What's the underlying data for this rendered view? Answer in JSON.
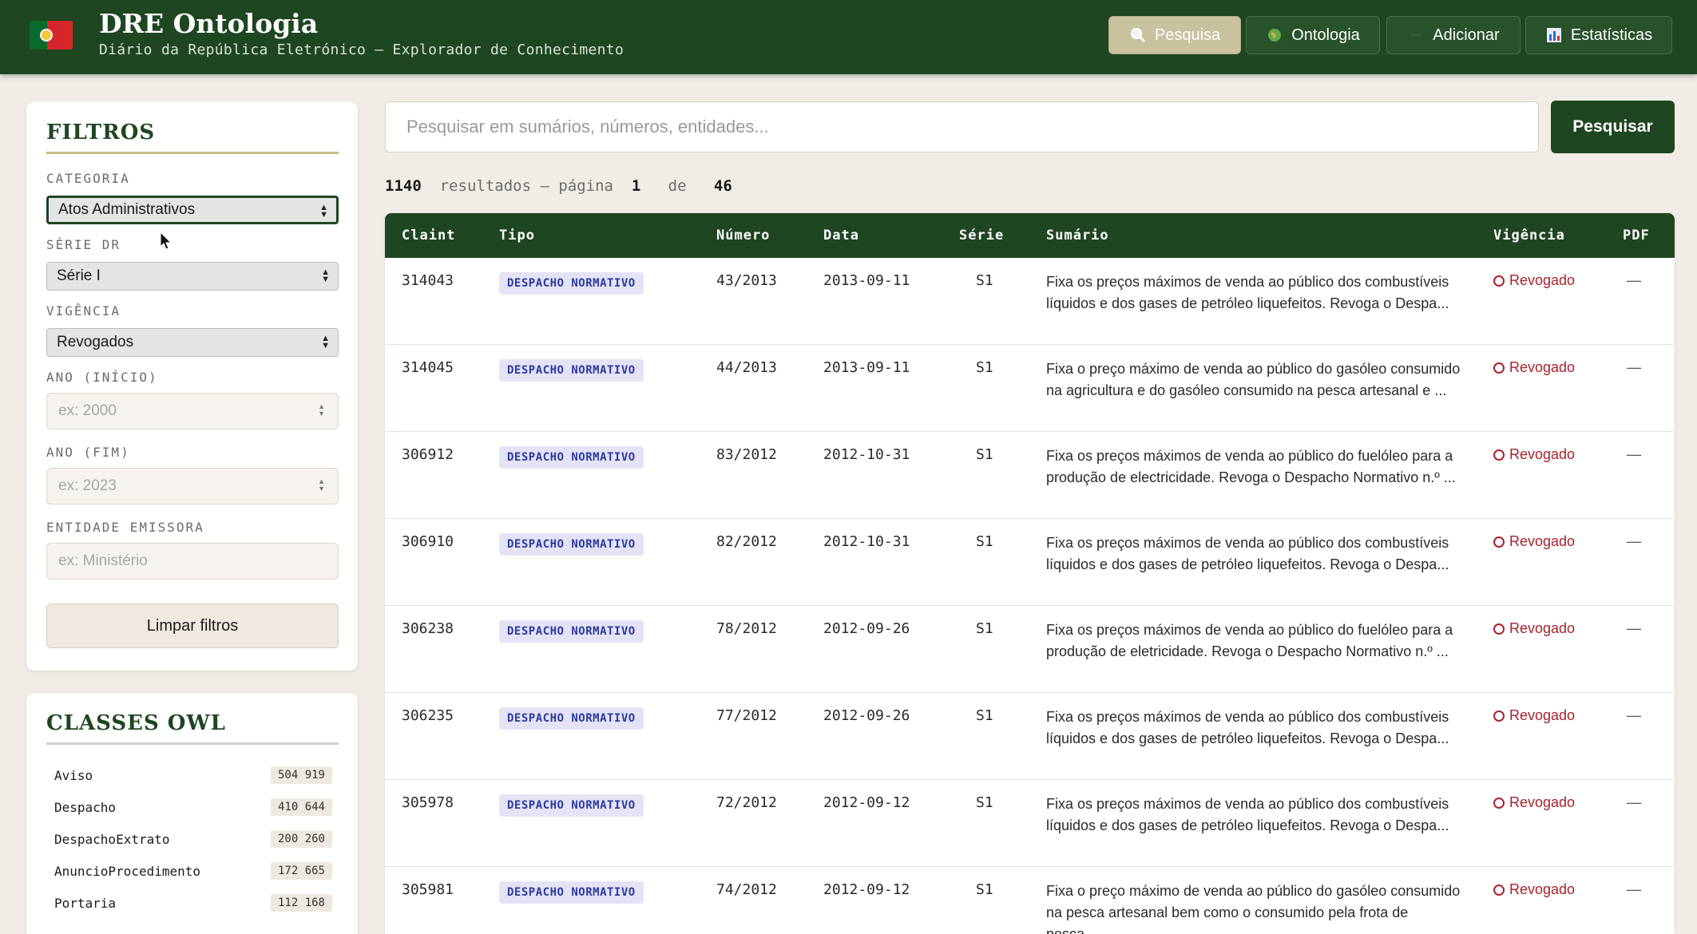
{
  "header": {
    "title": "DRE Ontologia",
    "subtitle": "Diário da República Eletrónico — Explorador de Conhecimento",
    "nav": [
      {
        "label": "Pesquisa",
        "icon": "magnifier-icon",
        "active": true
      },
      {
        "label": "Ontologia",
        "icon": "globe-icon",
        "active": false
      },
      {
        "label": "Adicionar",
        "icon": "plus-icon",
        "active": false
      },
      {
        "label": "Estatísticas",
        "icon": "bar-chart-icon",
        "active": false
      }
    ]
  },
  "filters": {
    "title": "FILTROS",
    "categoria": {
      "label": "CATEGORIA",
      "value": "Atos Administrativos"
    },
    "serie": {
      "label": "SÉRIE DR",
      "value": "Série I"
    },
    "vigencia": {
      "label": "VIGÊNCIA",
      "value": "Revogados"
    },
    "ano_inicio": {
      "label": "ANO (INÍCIO)",
      "placeholder": "ex: 2000"
    },
    "ano_fim": {
      "label": "ANO (FIM)",
      "placeholder": "ex: 2023"
    },
    "entidade": {
      "label": "ENTIDADE EMISSORA",
      "placeholder": "ex: Ministério"
    },
    "clear_label": "Limpar filtros"
  },
  "owl": {
    "title": "CLASSES OWL",
    "classes": [
      {
        "name": "Aviso",
        "count": "504 919"
      },
      {
        "name": "Despacho",
        "count": "410 644"
      },
      {
        "name": "DespachoExtrato",
        "count": "200 260"
      },
      {
        "name": "AnuncioProcedimento",
        "count": "172 665"
      },
      {
        "name": "Portaria",
        "count": "112 168"
      }
    ]
  },
  "search": {
    "placeholder": "Pesquisar em sumários, números, entidades...",
    "button_label": "Pesquisar"
  },
  "results": {
    "count": "1140",
    "text_resultados": "resultados — página",
    "page": "1",
    "text_de": "de",
    "total_pages": "46"
  },
  "table": {
    "headers": {
      "claint": "Claint",
      "tipo": "Tipo",
      "numero": "Número",
      "data": "Data",
      "serie": "Série",
      "sumario": "Sumário",
      "vigencia": "Vigência",
      "pdf": "PDF"
    },
    "rows": [
      {
        "claint": "314043",
        "tipo": "DESPACHO NORMATIVO",
        "numero": "43/2013",
        "data": "2013-09-11",
        "serie": "S1",
        "sumario": "Fixa os preços máximos de venda ao público dos combustíveis líquidos e dos gases de petróleo liquefeitos. Revoga o Despa...",
        "vigencia": "Revogado",
        "pdf": "—"
      },
      {
        "claint": "314045",
        "tipo": "DESPACHO NORMATIVO",
        "numero": "44/2013",
        "data": "2013-09-11",
        "serie": "S1",
        "sumario": "Fixa o preço máximo de venda ao público do gasóleo consumido na agricultura e do gasóleo consumido na pesca artesanal e ...",
        "vigencia": "Revogado",
        "pdf": "—"
      },
      {
        "claint": "306912",
        "tipo": "DESPACHO NORMATIVO",
        "numero": "83/2012",
        "data": "2012-10-31",
        "serie": "S1",
        "sumario": "Fixa os preços máximos de venda ao público do fuelóleo para a produção de electricidade. Revoga o Despacho Normativo n.º ...",
        "vigencia": "Revogado",
        "pdf": "—"
      },
      {
        "claint": "306910",
        "tipo": "DESPACHO NORMATIVO",
        "numero": "82/2012",
        "data": "2012-10-31",
        "serie": "S1",
        "sumario": "Fixa os preços máximos de venda ao público dos combustíveis líquidos e dos gases de petróleo liquefeitos. Revoga o Despa...",
        "vigencia": "Revogado",
        "pdf": "—"
      },
      {
        "claint": "306238",
        "tipo": "DESPACHO NORMATIVO",
        "numero": "78/2012",
        "data": "2012-09-26",
        "serie": "S1",
        "sumario": "Fixa os preços máximos de venda ao público do fuelóleo para a produção de eletricidade. Revoga o Despacho Normativo n.º ...",
        "vigencia": "Revogado",
        "pdf": "—"
      },
      {
        "claint": "306235",
        "tipo": "DESPACHO NORMATIVO",
        "numero": "77/2012",
        "data": "2012-09-26",
        "serie": "S1",
        "sumario": "Fixa os preços máximos de venda ao público dos combustíveis líquidos e dos gases de petróleo liquefeitos. Revoga o Despa...",
        "vigencia": "Revogado",
        "pdf": "—"
      },
      {
        "claint": "305978",
        "tipo": "DESPACHO NORMATIVO",
        "numero": "72/2012",
        "data": "2012-09-12",
        "serie": "S1",
        "sumario": "Fixa os preços máximos de venda ao público dos combustíveis líquidos e dos gases de petróleo liquefeitos. Revoga o Despa...",
        "vigencia": "Revogado",
        "pdf": "—"
      },
      {
        "claint": "305981",
        "tipo": "DESPACHO NORMATIVO",
        "numero": "74/2012",
        "data": "2012-09-12",
        "serie": "S1",
        "sumario": "Fixa o preço máximo de venda ao público do gasóleo consumido na pesca artesanal bem como o consumido pela frota de pesca...",
        "vigencia": "Revogado",
        "pdf": "—"
      }
    ]
  },
  "colors": {
    "primary": "#1e4620",
    "accent": "#c7bb7f",
    "danger": "#a8222d",
    "badge_bg": "#e4e3f6",
    "badge_text": "#2b3a9e"
  }
}
